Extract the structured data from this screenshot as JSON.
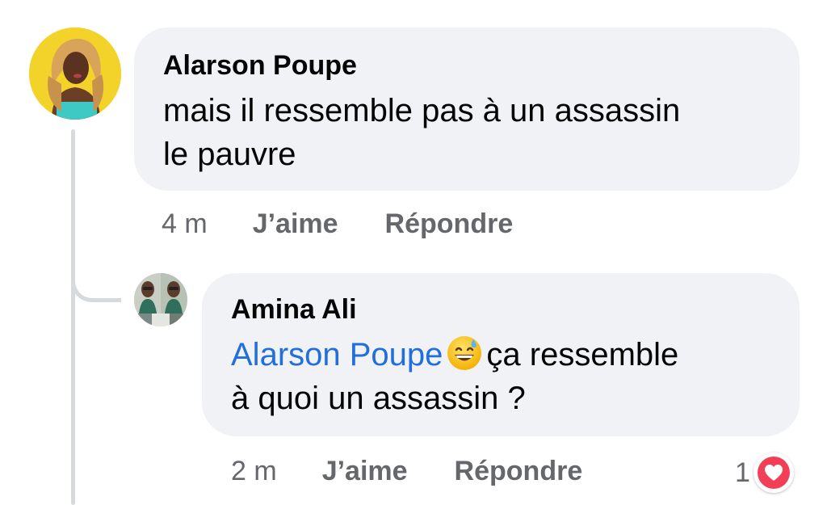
{
  "comment": {
    "author": "Alarson Poupe",
    "text": "mais il ressemble pas à un assassin\nle pauvre",
    "time": "4 m",
    "like_label": "J’aime",
    "reply_label": "Répondre"
  },
  "reply": {
    "author": "Amina Ali",
    "mention": "Alarson Poupe",
    "emoji": "grinning-face-with-sweat-icon",
    "text": "ça ressemble\nà quoi un assassin ?",
    "time": "2 m",
    "like_label": "J’aime",
    "reply_label": "Répondre",
    "reaction_count": "1",
    "reaction_icon": "heart-reaction-icon"
  },
  "colors": {
    "bubble": "#f0f2f5",
    "mention": "#216fdb",
    "meta": "#65676b",
    "heart": "#f33e58",
    "thread_line": "#d6d9de"
  }
}
